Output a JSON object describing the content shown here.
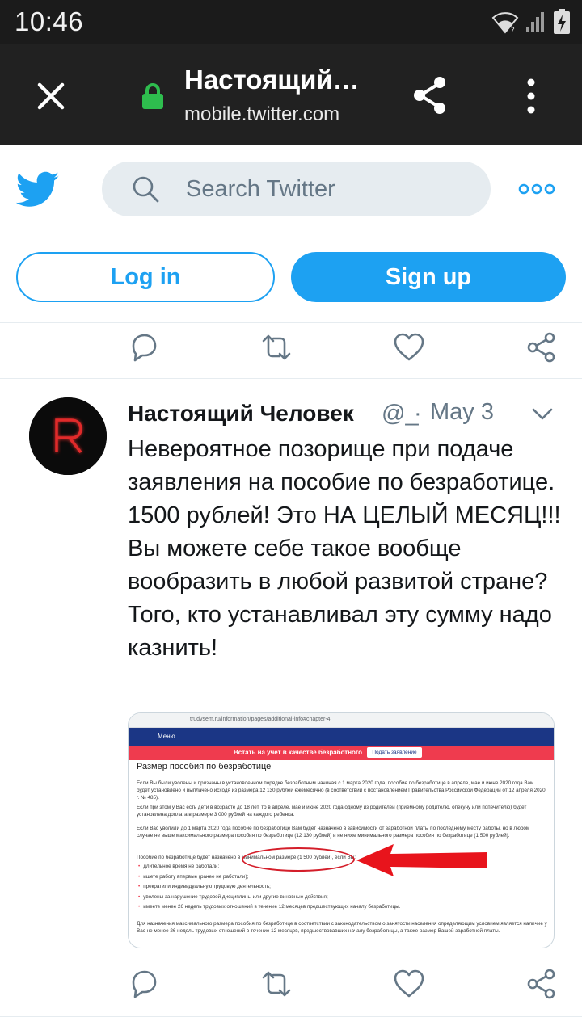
{
  "status_bar": {
    "time": "10:46"
  },
  "toolbar": {
    "title": "Настоящий…",
    "url": "mobile.twitter.com"
  },
  "header": {
    "search_placeholder": "Search Twitter",
    "login_label": "Log in",
    "signup_label": "Sign up"
  },
  "tweet": {
    "author_name": "Настоящий Человек",
    "author_handle": "@_",
    "separator": "·",
    "date": "May 3",
    "text": "Невероятное позорище при подаче заявления на пособие по безработице. 1500 рублей! Это НА ЦЕЛЫЙ МЕСЯЦ!!! Вы можете себе такое вообще вообразить в любой развитой стране? Того, кто устанавливал эту сумму надо казнить!",
    "avatar_letter": "R"
  },
  "media": {
    "url": "trudvsem.ru/information/pages/additional-info#chapter-4",
    "menu": "Меню",
    "banner_text": "Встать на учет в качестве безработного",
    "banner_button": "Подать заявление",
    "heading": "Размер пособия по безработице",
    "p1": "Если Вы были уволены и признаны в установленном порядке безработным начиная с 1 марта 2020 года, пособие по безработице в апреле, мае и июне 2020 года Вам будет установлено и выплачено исходя из размера 12 130 рублей ежемесячно (в соответствии с постановлением Правительства Российской Федерации от 12 апреля 2020 г. № 485).",
    "p2": "Если при этом у Вас есть дети в возрасте до 18 лет, то в апреле, мае и июне 2020 года одному из родителей (приемному родителю, опекуну или попечителю) будет установлена доплата в размере 3 000 рублей на каждого ребенка.",
    "p3": "Если Вас уволили до 1 марта 2020 года пособие по безработице Вам будет назначено в зависимости от заработной платы по последнему месту работы, но в любом случае не выше максимального размера пособия по безработице (12 130 рублей) и не ниже минимального размера пособия по безработице (1 500 рублей).",
    "p4": "Пособие по безработице будет назначено в минимальном размере (1 500 рублей), если Вы:",
    "list": [
      "длительное время не работали;",
      "ищете работу впервые (ранее не работали);",
      "прекратили индивидуальную трудовую деятельность;",
      "уволены за нарушение трудовой дисциплины или другие виновные действия;",
      "имеете менее 26 недель трудовых отношений в течение 12 месяцев предшествующих началу безработицы."
    ],
    "p5": "Для назначения максимального размера пособия по безработице в соответствии с законодательством о занятости населения определяющим условием является наличие у Вас не менее 26 недель трудовых отношений в течение 12 месяцев, предшествовавших началу безработицы, а также размер Вашей заработной платы."
  },
  "colors": {
    "twitter_blue": "#1da1f2",
    "status_bar": "#1b1b1b",
    "toolbar": "#212121",
    "lock_green": "#2ebd4e",
    "icon_gray": "#657786"
  }
}
